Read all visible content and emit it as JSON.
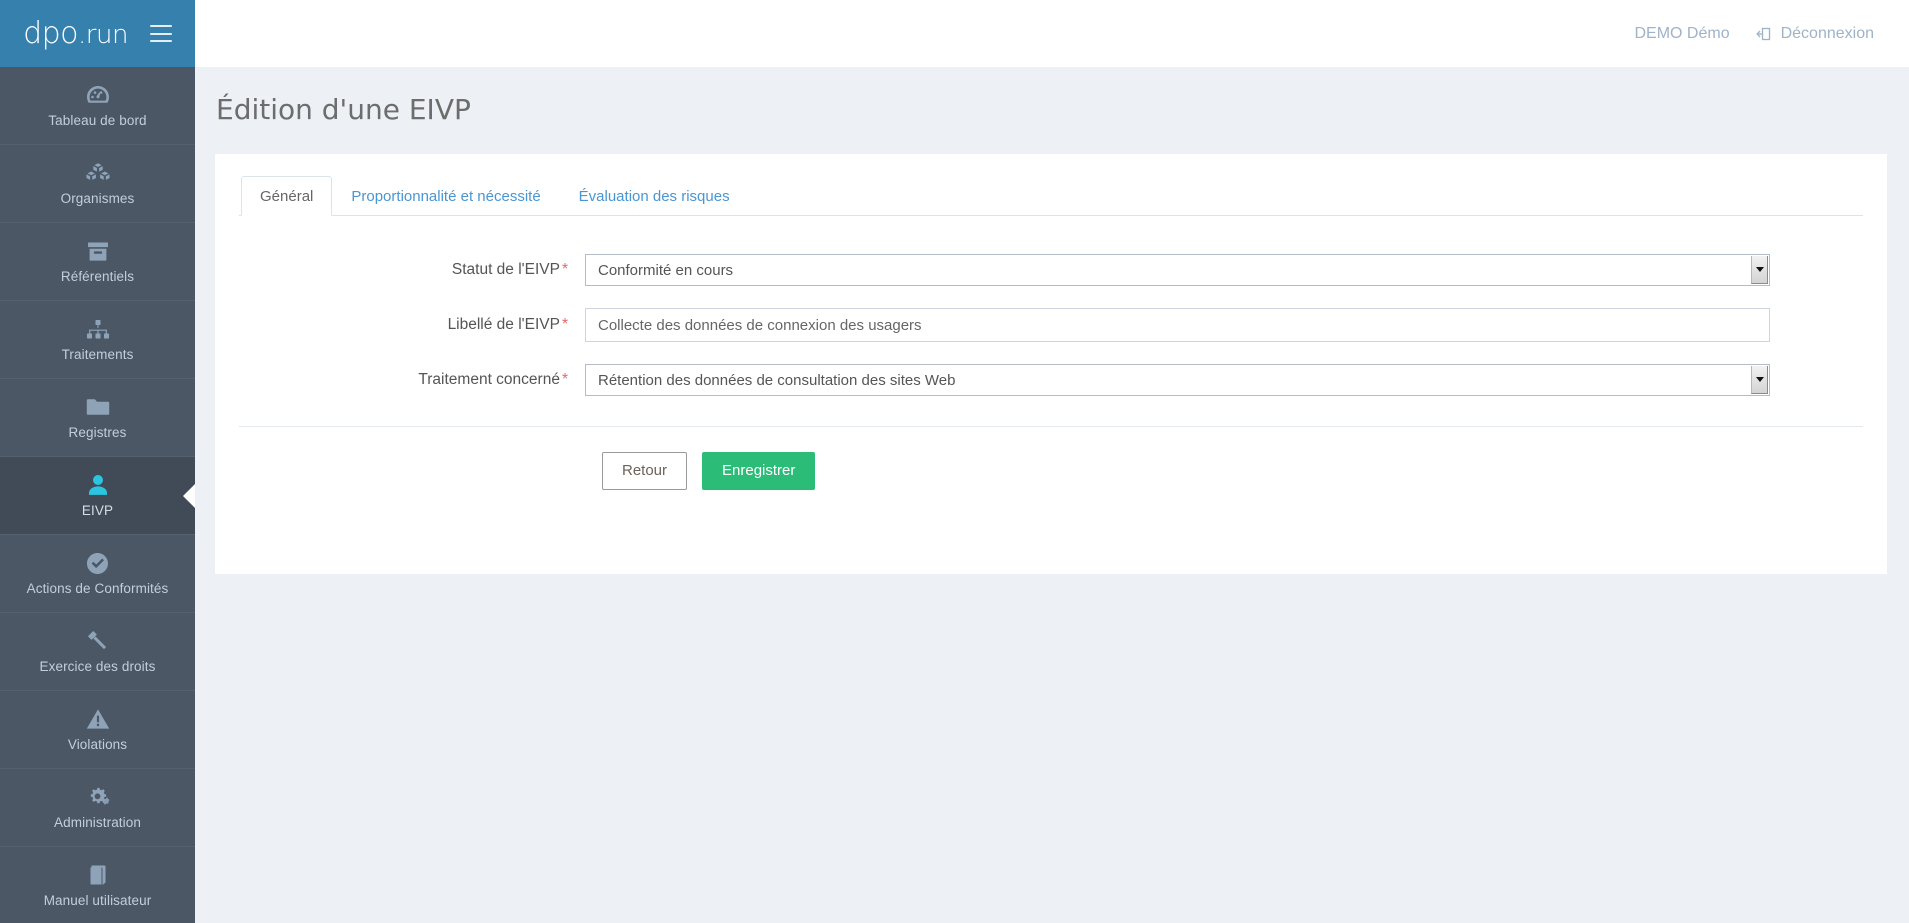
{
  "brand": {
    "logo_main": "dpo",
    "logo_suffix": ".run",
    "menu_icon": "hamburger-icon"
  },
  "topbar": {
    "user_name": "DEMO Démo",
    "logout_label": "Déconnexion",
    "logout_icon": "sign-out-icon"
  },
  "sidebar": {
    "items": [
      {
        "label": "Tableau de bord",
        "icon": "dashboard-icon",
        "active": false
      },
      {
        "label": "Organismes",
        "icon": "cubes-icon",
        "active": false
      },
      {
        "label": "Référentiels",
        "icon": "archive-icon",
        "active": false
      },
      {
        "label": "Traitements",
        "icon": "sitemap-icon",
        "active": false
      },
      {
        "label": "Registres",
        "icon": "folder-icon",
        "active": false
      },
      {
        "label": "EIVP",
        "icon": "user-icon",
        "active": true
      },
      {
        "label": "Actions de Conformités",
        "icon": "check-circle-icon",
        "active": false
      },
      {
        "label": "Exercice des droits",
        "icon": "gavel-icon",
        "active": false
      },
      {
        "label": "Violations",
        "icon": "warning-triangle-icon",
        "active": false
      },
      {
        "label": "Administration",
        "icon": "cogs-icon",
        "active": false
      },
      {
        "label": "Manuel utilisateur",
        "icon": "book-icon",
        "active": false
      }
    ]
  },
  "page": {
    "title": "Édition d'une EIVP"
  },
  "tabs": [
    {
      "label": "Général",
      "active": true
    },
    {
      "label": "Proportionnalité et nécessité",
      "active": false
    },
    {
      "label": "Évaluation des risques",
      "active": false
    }
  ],
  "form": {
    "fields": [
      {
        "label": "Statut de l'EIVP",
        "required_marker": "*",
        "type": "select",
        "value": "Conformité en cours"
      },
      {
        "label": "Libellé de l'EIVP",
        "required_marker": "*",
        "type": "text",
        "value": "Collecte des données de connexion des usagers",
        "placeholder": ""
      },
      {
        "label": "Traitement concerné",
        "required_marker": "*",
        "type": "select",
        "value": "Rétention des données de consultation des sites Web"
      }
    ]
  },
  "actions": {
    "back_label": "Retour",
    "save_label": "Enregistrer"
  },
  "colors": {
    "brand_blue": "#3680ae",
    "sidebar": "#4c5766",
    "sidebar_active": "#414b57",
    "accent_cyan": "#2ac5e0",
    "link_blue": "#4a96d2",
    "success_green": "#2bbd78",
    "page_bg": "#edf1f5",
    "required_red": "#e8656a"
  }
}
